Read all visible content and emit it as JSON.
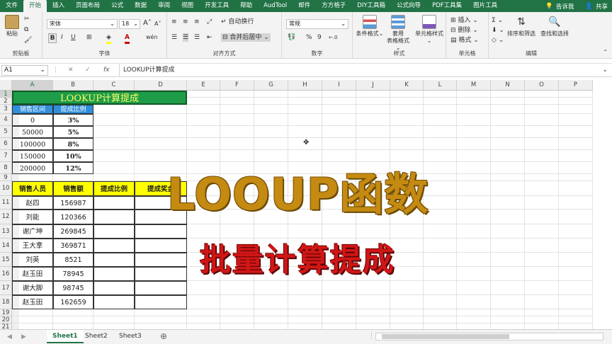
{
  "ribbon_tabs": [
    "文件",
    "开始",
    "插入",
    "页面布局",
    "公式",
    "数据",
    "审阅",
    "视图",
    "开发工具",
    "帮助",
    "AudTool",
    "邮件",
    "方方格子",
    "DIY工具箱",
    "公式向导",
    "PDF工具集",
    "图片工具"
  ],
  "tell_me": "告诉我",
  "share": "共享",
  "clipboard": {
    "paste": "粘贴",
    "label": "剪贴板"
  },
  "font": {
    "name": "宋体",
    "size": "18",
    "bold": "B",
    "italic": "I",
    "underline": "U",
    "grow": "A",
    "shrink": "A",
    "wen": "wén",
    "label": "字体"
  },
  "alignment": {
    "wrap": "自动换行",
    "merge": "合并后居中",
    "label": "对齐方式"
  },
  "number": {
    "format": "常规",
    "percent": "%",
    "comma": "9",
    "label": "数字"
  },
  "styles": {
    "conditional": "条件格式",
    "table_line1": "套用",
    "table_line2": "表格格式",
    "cell_style": "单元格样式",
    "label": "样式"
  },
  "cells": {
    "insert": "插入",
    "delete": "删除",
    "format": "格式",
    "label": "单元格"
  },
  "editing": {
    "sort": "排序和筛选",
    "find": "查找和选择",
    "label": "编辑"
  },
  "formula_bar": {
    "name_box": "A1",
    "fx": "fx",
    "content": "LOOKUP计算提成"
  },
  "columns": [
    "A",
    "B",
    "C",
    "D",
    "E",
    "F",
    "G",
    "H",
    "I",
    "J",
    "K",
    "L",
    "M",
    "N",
    "O",
    "P"
  ],
  "rows": [
    "1",
    "2",
    "3",
    "4",
    "5",
    "6",
    "7",
    "8",
    "9",
    "10",
    "11",
    "12",
    "13",
    "14",
    "15",
    "16",
    "17",
    "18",
    "19",
    "20",
    "21"
  ],
  "title_cell": "LOOKUP计算提成",
  "rate_table": {
    "headers": [
      "销售区间",
      "提成比例"
    ],
    "rows": [
      [
        "0",
        "3%"
      ],
      [
        "50000",
        "5%"
      ],
      [
        "100000",
        "8%"
      ],
      [
        "150000",
        "10%"
      ],
      [
        "200000",
        "12%"
      ]
    ]
  },
  "sales_table": {
    "headers": [
      "销售人员",
      "销售额",
      "提成比例",
      "提成奖金"
    ],
    "rows": [
      [
        "赵四",
        "156987"
      ],
      [
        "刘能",
        "120366"
      ],
      [
        "谢广坤",
        "269845"
      ],
      [
        "王大拿",
        "369871"
      ],
      [
        "刘英",
        "8521"
      ],
      [
        "赵玉田",
        "78945"
      ],
      [
        "谢大脚",
        "98745"
      ],
      [
        "赵玉田",
        "162659"
      ]
    ]
  },
  "overlay_title": "LOOUP函数",
  "overlay_subtitle": "批量计算提成",
  "sheets": [
    "Sheet1",
    "Sheet2",
    "Sheet3"
  ],
  "colors": {
    "excel_green": "#217346",
    "title_fill": "#1f9c48",
    "header_blue": "#2f8fdc",
    "header_yellow": "#ffff00",
    "overlay_gold": "#c48a12",
    "overlay_red": "#d11616"
  }
}
